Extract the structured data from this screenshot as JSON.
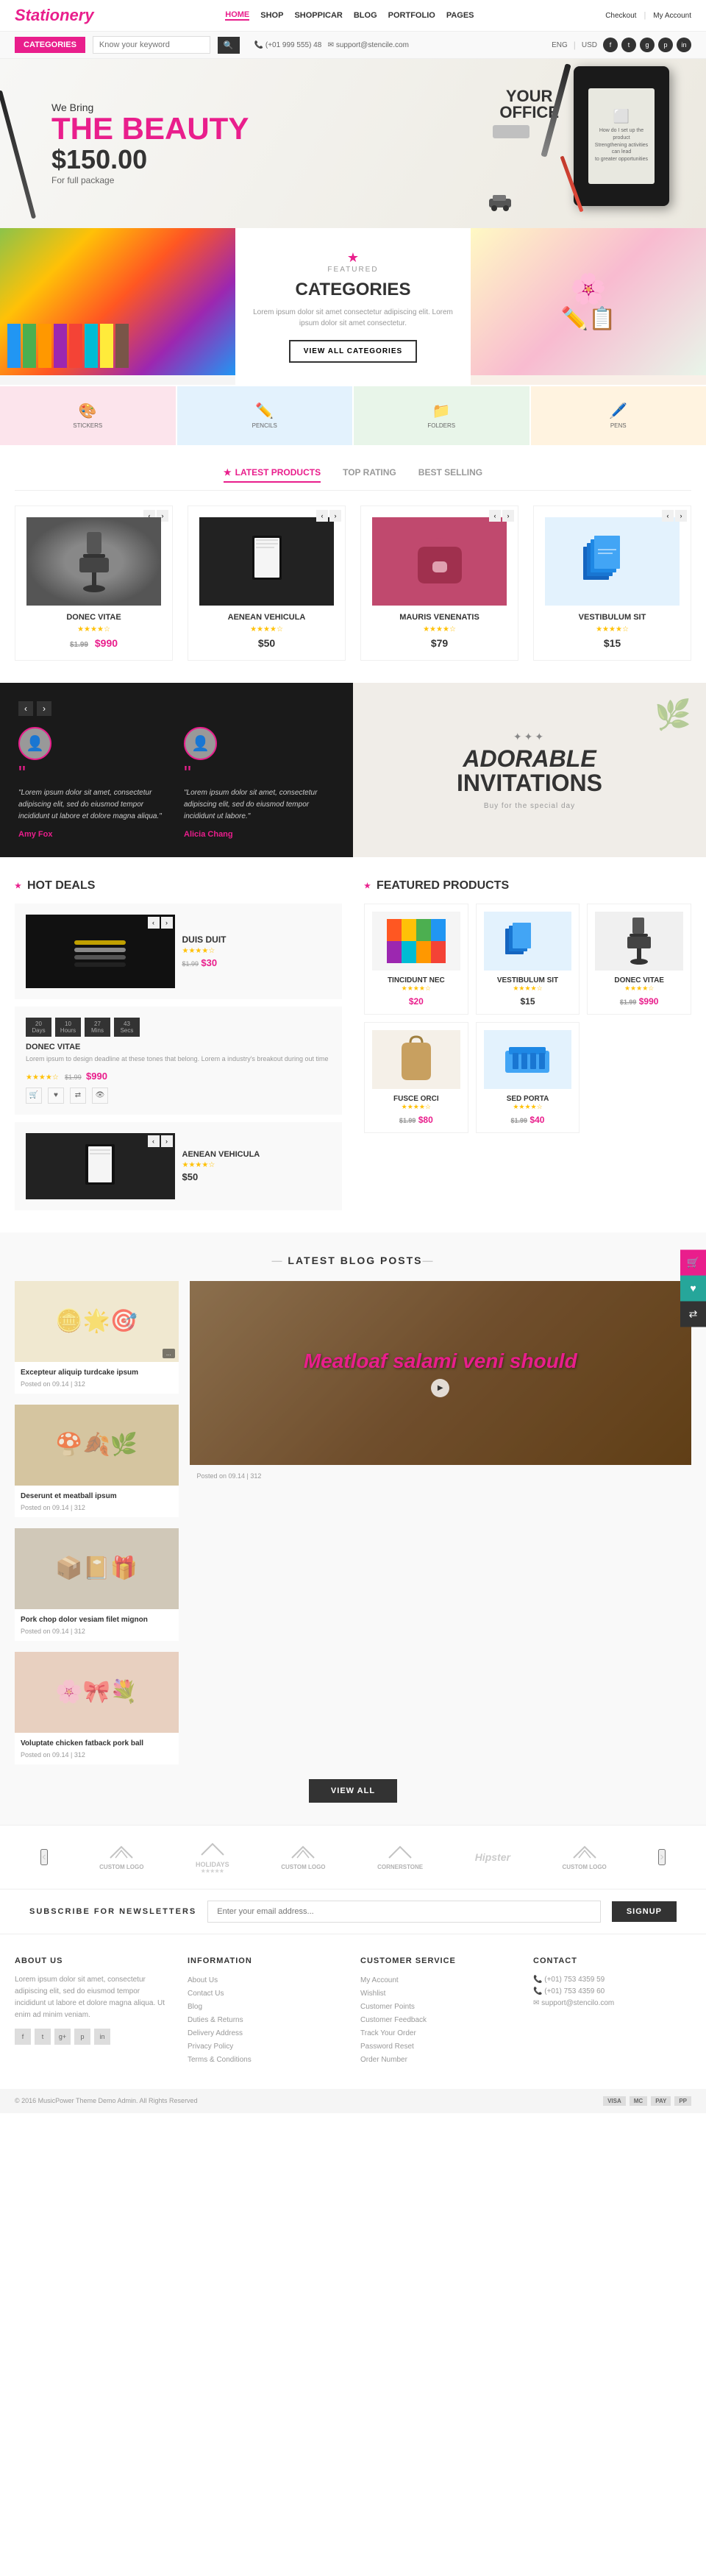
{
  "header": {
    "logo": "Stationery",
    "nav": [
      {
        "label": "HOME",
        "active": true
      },
      {
        "label": "SHOP",
        "active": false
      },
      {
        "label": "SHOPPICAR",
        "active": false
      },
      {
        "label": "BLOG",
        "active": false
      },
      {
        "label": "PORTFOLIO",
        "active": false
      },
      {
        "label": "PAGES",
        "active": false
      }
    ],
    "right_links": [
      "Checkout",
      "My Account"
    ],
    "categories_btn": "Categories",
    "search_placeholder": "Know your keyword",
    "phone": "(+01 999 555) 48",
    "email": "support@stencile.com",
    "currency": "USD",
    "language": "ENG"
  },
  "hero": {
    "subtitle": "We Bring",
    "title": "THE BEAUTY",
    "price": "$150.00",
    "price_desc": "For full package",
    "office_text1": "YOUR",
    "office_text2": "OFFICE"
  },
  "featured": {
    "label": "FEATURED",
    "title": "CATEGORIES",
    "description": "Lorem ipsum dolor sit amet consectetur adipiscing elit. Lorem ipsum dolor sit amet consectetur.",
    "view_all_btn": "VIEW ALL CATEGORIES"
  },
  "products": {
    "tabs": [
      {
        "label": "LATEST PRODUCTS",
        "active": true
      },
      {
        "label": "TOP RATING",
        "active": false
      },
      {
        "label": "BEST SELLING",
        "active": false
      }
    ],
    "items": [
      {
        "name": "DONEC VITAE",
        "stars": 4,
        "price_old": "$1.99",
        "price_new": "$990",
        "img_type": "chair"
      },
      {
        "name": "AENEAN VEHICULA",
        "stars": 4,
        "price": "$50",
        "img_type": "binder"
      },
      {
        "name": "MAURIS VENENATIS",
        "stars": 4,
        "price": "$79",
        "img_type": "purse"
      },
      {
        "name": "VESTIBULUM SIT",
        "stars": 4,
        "price": "$15",
        "img_type": "folders"
      }
    ]
  },
  "testimonials": {
    "left_quote1": "\"Lorem ipsum dolor sit amet, consectetur adipiscing elit, sed do eiusmod tempor incididunt ut labore et dolore magna aliqua.\"",
    "author1": "Amy Fox",
    "left_quote2": "\"Lorem ipsum dolor sit amet, consectetur adipiscing elit, sed do eiusmod tempor incididunt ut labore.\"",
    "author2": "Alicia Chang",
    "right_title1": "ADORABLE",
    "right_title2": "INVITATIONS",
    "right_sub": "Buy for the special day"
  },
  "hot_deals": {
    "section_title": "HOT DEALS",
    "product1": {
      "name": "DUIS DUIT",
      "price_old": "$1.99",
      "price": "$30",
      "img_type": "pens"
    },
    "timer": {
      "days": "20",
      "hours": "10",
      "minutes": "27",
      "seconds": "43"
    },
    "timer_labels": [
      "Days",
      "Hours",
      "Mins",
      "Secs"
    ],
    "product2": {
      "name": "DONEC VITAE",
      "price_old": "$1.99",
      "price": "$990",
      "img_type": "chair"
    },
    "product3": {
      "name": "AENEAN VEHICULA",
      "price": "$50",
      "img_type": "binder"
    }
  },
  "featured_products": {
    "section_title": "FEATURED PRODUCTS",
    "items": [
      {
        "name": "TINCIDUNT NEC",
        "price": "$20",
        "img_type": "colorful"
      },
      {
        "name": "VESTIBULUM SIT",
        "price": "$15",
        "img_type": "folders"
      },
      {
        "name": "DONEC VITAE",
        "price_old": "$1.99",
        "price": "$990",
        "img_type": "chair"
      },
      {
        "name": "FUSCE ORCI",
        "price_old": "$1.99",
        "price": "$80",
        "img_type": "bag"
      },
      {
        "name": "SED PORTA",
        "price_old": "$1.99",
        "price": "$40",
        "img_type": "tray"
      }
    ]
  },
  "blog": {
    "section_title": "LATEST BLOG POSTS",
    "view_all_btn": "VIEW ALL",
    "posts": [
      {
        "title": "Excepteur aliquip turdcake ipsum",
        "meta": "Posted on 09.14 | 312",
        "img_type": "stamp"
      },
      {
        "title": "Meatloaf salami veni should",
        "meta": "Posted on 09.14 | 312",
        "img_type": "frame",
        "is_main": true
      },
      {
        "title": "Pork chop dolor vesiam filet mignon",
        "meta": "Posted on 09.14 | 312",
        "img_type": "tools"
      },
      {
        "title": "Deserunt et meatball ipsum",
        "meta": "Posted on 09.14 | 312",
        "img_type": "stamp2"
      },
      {
        "title": "Voluptate chicken fatback pork ball",
        "meta": "Posted on 09.14 | 312",
        "img_type": "flowers2"
      }
    ]
  },
  "brands": [
    "CUSTOM LOGO",
    "HOLIDAYS",
    "CUSTOM LOGO",
    "CORNERSTONE",
    "Hipster",
    "CUSTOM LOGO"
  ],
  "newsletter": {
    "label": "SUBSCRIBE FOR NEWSLETTERS",
    "placeholder": "Enter your email address...",
    "btn": "SIGNUP"
  },
  "footer": {
    "about_title": "ABOUT US",
    "about_text": "Lorem ipsum dolor sit amet, consectetur adipiscing elit, sed do eiusmod tempor incididunt ut labore et dolore magna aliqua. Ut enim ad minim veniam.",
    "info_title": "INFORMATION",
    "info_links": [
      "About Us",
      "Contact Us",
      "Blog",
      "Duties & Returns",
      "Delivery Address",
      "Privacy Policy",
      "Terms & Conditions"
    ],
    "customer_title": "CUSTOMER SERVICE",
    "customer_links": [
      "My Account",
      "Wishlist",
      "Customer Points",
      "Customer Feedback",
      "Track Your Order",
      "Password Reset",
      "Order Number"
    ],
    "contact_title": "CONTACT",
    "contact_phone": "(+01) 753 4359 59",
    "contact_phone2": "(+01) 753 4359 60",
    "contact_email": "support@stencilo.com",
    "copyright": "© 2016 MusicPower Theme Demo Admin. All Rights Reserved",
    "payment_icons": [
      "VISA",
      "MC",
      "PAY",
      "PP"
    ]
  }
}
